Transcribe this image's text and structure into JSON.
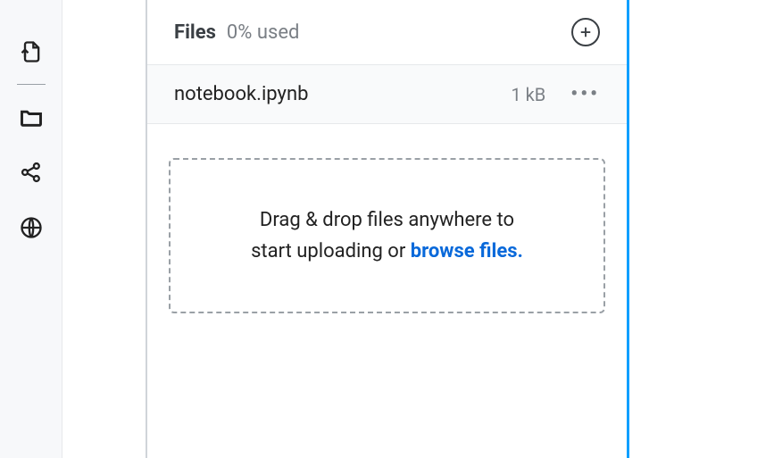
{
  "sidebar": {
    "icons": {
      "upload": "upload-file-icon",
      "files": "folder-icon",
      "share": "share-nodes-icon",
      "web": "globe-icon"
    }
  },
  "panel": {
    "title": "Files",
    "usage": "0% used",
    "add_label": "Add file"
  },
  "files": [
    {
      "name": "notebook.ipynb",
      "size": "1 kB"
    }
  ],
  "dropzone": {
    "line1": "Drag & drop files anywhere to",
    "line2a": "start uploading or ",
    "line2b": "browse files."
  }
}
